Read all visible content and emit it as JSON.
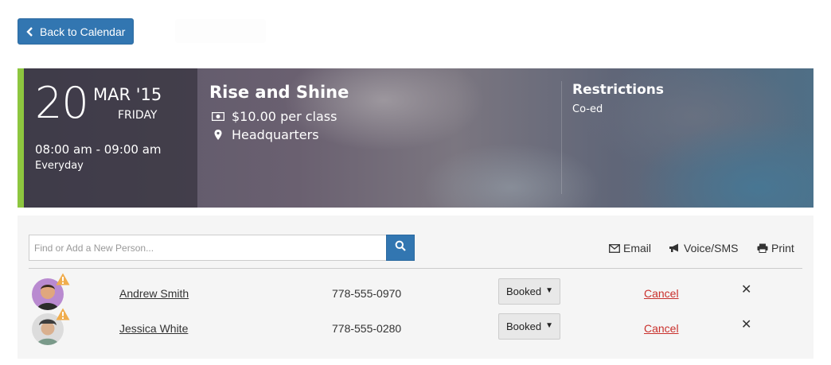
{
  "toolbar": {
    "back_label": "Back to Calendar"
  },
  "event": {
    "day": "20",
    "month": "MAR '15",
    "weekday": "FRIDAY",
    "time": "08:00 am - 09:00 am",
    "frequency": "Everyday",
    "title": "Rise and Shine",
    "price": "$10.00 per class",
    "location": "Headquarters",
    "restrictions_title": "Restrictions",
    "restrictions_value": "Co-ed",
    "accent_color": "#8dc63f"
  },
  "search": {
    "placeholder": "Find or Add a New Person...",
    "value": ""
  },
  "actions": {
    "email": "Email",
    "voice": "Voice/SMS",
    "print": "Print"
  },
  "attendees": [
    {
      "name": "Andrew Smith",
      "phone": "778-555-0970",
      "status": "Booked",
      "cancel": "Cancel"
    },
    {
      "name": "Jessica White",
      "phone": "778-555-0280",
      "status": "Booked",
      "cancel": "Cancel"
    }
  ],
  "colors": {
    "primary": "#3276b1",
    "danger": "#c9302c",
    "warning": "#f0ad4e"
  }
}
